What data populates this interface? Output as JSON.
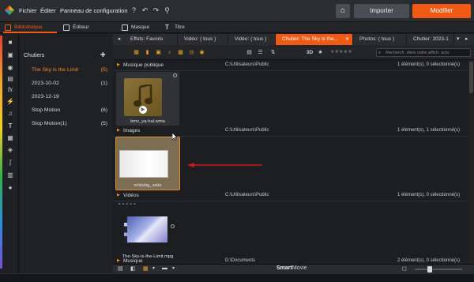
{
  "menu": {
    "items": [
      "Fichier",
      "Éditer",
      "Panneau de configuration"
    ]
  },
  "header": {
    "import_label": "Importer",
    "edit_label": "Modifier"
  },
  "modes": [
    {
      "label": "Bibliothèque"
    },
    {
      "label": "Éditeur"
    },
    {
      "label": "Masque"
    },
    {
      "label": "Titre"
    }
  ],
  "collections": {
    "heading": "Chutiers",
    "items": [
      {
        "label": "The Sky is the Limit",
        "count": "(5)"
      },
      {
        "label": "2023-10-02",
        "count": "(1)"
      },
      {
        "label": "2023-12-19",
        "count": ""
      },
      {
        "label": "Stop Motion",
        "count": "(6)"
      },
      {
        "label": "Stop Motion(1)",
        "count": "(5)"
      }
    ]
  },
  "library_tabs": [
    {
      "label": "Effets: Favoris"
    },
    {
      "label": "Vidéo: ( tous )"
    },
    {
      "label": "Vidéo: ( tous )"
    },
    {
      "label": "Chutier: The Sky is the..."
    },
    {
      "label": "Photos: ( tous )"
    },
    {
      "label": "Chutier: 2023-1"
    }
  ],
  "toolbar": {
    "mode_3d": "3D",
    "search_placeholder": "Recherch. dans votre affich. actu"
  },
  "groups": [
    {
      "name": "Musique publique",
      "path": "C:\\Utilisateurs\\Public",
      "status": "1 élément(s), 0 sélectionné(s)"
    },
    {
      "name": "Images",
      "path": "C:\\Utilisateurs\\Public",
      "status": "1 élément(s), 1 sélectionné(s)"
    },
    {
      "name": "Vidéos",
      "path": "C:\\Utilisateurs\\Public",
      "status": "1 élément(s), 0 sélectionné(s)"
    },
    {
      "name": "Musique",
      "path": "D:\\Documents",
      "status": "2 élément(s), 0 sélectionné(s)"
    }
  ],
  "items": {
    "music": "bmv_ya-hal.wma",
    "image": "whitebg_wide",
    "video": "The-Sky-is-the-Limit.mpg"
  },
  "bottom": {
    "brand_bold": "Smart",
    "brand_light": "Movie"
  },
  "colors": {
    "accent": "#f05a14",
    "selection": "#f28c28",
    "arrow": "#d01818"
  },
  "icons": [
    "app-logo-icon",
    "help-icon",
    "undo-icon",
    "redo-icon",
    "link-icon",
    "home-icon",
    "search-icon",
    "star-icon"
  ]
}
